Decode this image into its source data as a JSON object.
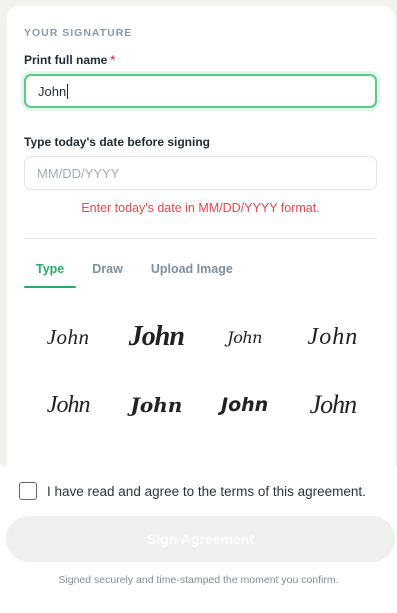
{
  "section_title": "YOUR SIGNATURE",
  "name_field": {
    "label": "Print full name",
    "required_mark": "*",
    "value": "John"
  },
  "date_field": {
    "label": "Type today's date before signing",
    "placeholder": "MM/DD/YYYY",
    "error": "Enter today's date in MM/DD/YYYY format."
  },
  "tabs": [
    {
      "label": "Type",
      "active": true
    },
    {
      "label": "Draw",
      "active": false
    },
    {
      "label": "Upload Image",
      "active": false
    }
  ],
  "signature_options": [
    "John",
    "John",
    "John",
    "John",
    "John",
    "John",
    "John",
    "John"
  ],
  "agreement": {
    "text": "I have read and agree to the terms of this agreement.",
    "checked": false
  },
  "sign_button": {
    "label": "Sign Agreement",
    "enabled": false
  },
  "footer_note": "Signed securely and time-stamped the moment you confirm.",
  "colors": {
    "accent": "#2aa96a",
    "error": "#e5484d",
    "focus_border": "#5cc98a"
  }
}
